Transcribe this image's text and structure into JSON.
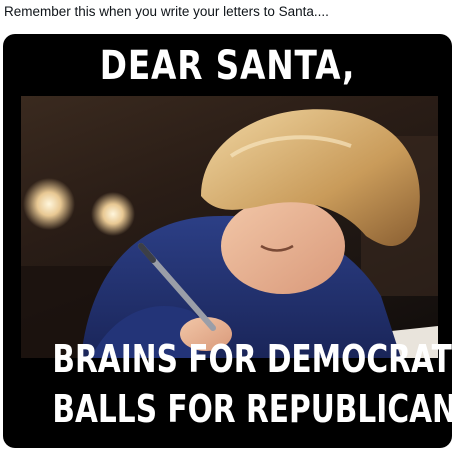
{
  "post": {
    "text": "Remember this when you write your letters to Santa...."
  },
  "meme": {
    "title": "DEAR SANTA,",
    "caption_line_1": "BRAINS FOR DEMOCRATS",
    "caption_line_2": "BALLS FOR REPUBLICANS"
  }
}
